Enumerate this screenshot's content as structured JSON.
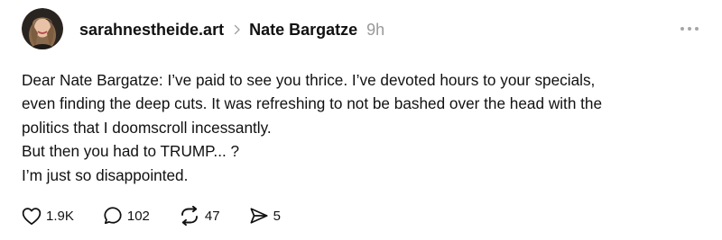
{
  "post": {
    "username": "sarahnestheide.art",
    "topic": "Nate Bargatze",
    "time": "9h",
    "body_lines": [
      "Dear Nate Bargatze: I’ve paid to see you thrice. I’ve devoted hours to your specials,",
      "even finding the deep cuts. It was refreshing to not be bashed over the head with the",
      "politics that I doomscroll incessantly.",
      "But then you had to TRUMP... ?",
      "I’m just so disappointed."
    ],
    "actions": {
      "likes": "1.9K",
      "replies": "102",
      "reposts": "47",
      "shares": "5"
    }
  },
  "icons": {
    "breadcrumb": "chevron-right-icon",
    "more": "more-horizontal-icon",
    "like": "heart-icon",
    "reply": "comment-icon",
    "repost": "repost-icon",
    "share": "send-icon"
  },
  "colors": {
    "text": "#111111",
    "muted": "#999999",
    "background": "#ffffff"
  }
}
